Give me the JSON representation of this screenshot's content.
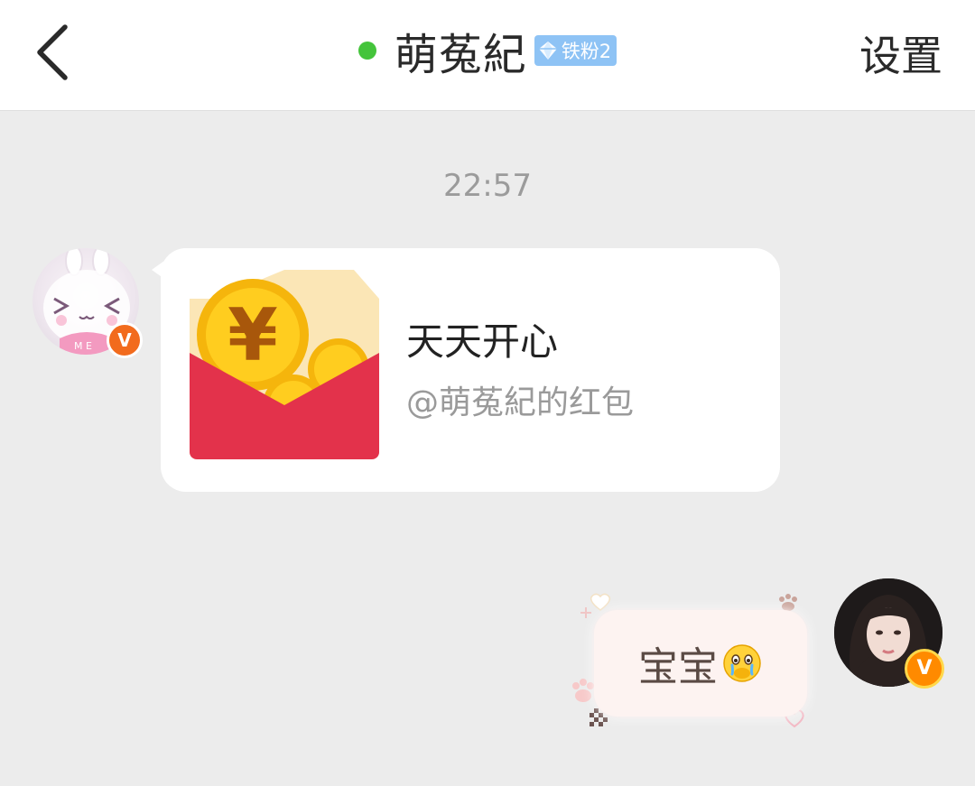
{
  "header": {
    "title": "萌菟紀",
    "fan_badge": "铁粉2",
    "settings_label": "设置",
    "online_color": "#44c43b"
  },
  "chat": {
    "timestamp": "22:57",
    "messages": [
      {
        "side": "left",
        "type": "red-packet",
        "title": "天天开心",
        "subtitle": "@萌菟紀的红包",
        "avatar_badge": "V"
      },
      {
        "side": "right",
        "type": "text",
        "text": "宝宝",
        "emoji": "crying-face-hands-over-mouth",
        "avatar_badge": "V"
      }
    ]
  },
  "colors": {
    "background": "#ececec",
    "bubble_left": "#ffffff",
    "bubble_right": "#fdf3f1",
    "red_packet": "#e3324b",
    "coin": "#f5b50c",
    "v_badge": "#f26b1d"
  },
  "icons": {
    "back": "chevron-left-icon",
    "fan_badge": "diamond-icon",
    "verified": "v-badge-icon"
  }
}
